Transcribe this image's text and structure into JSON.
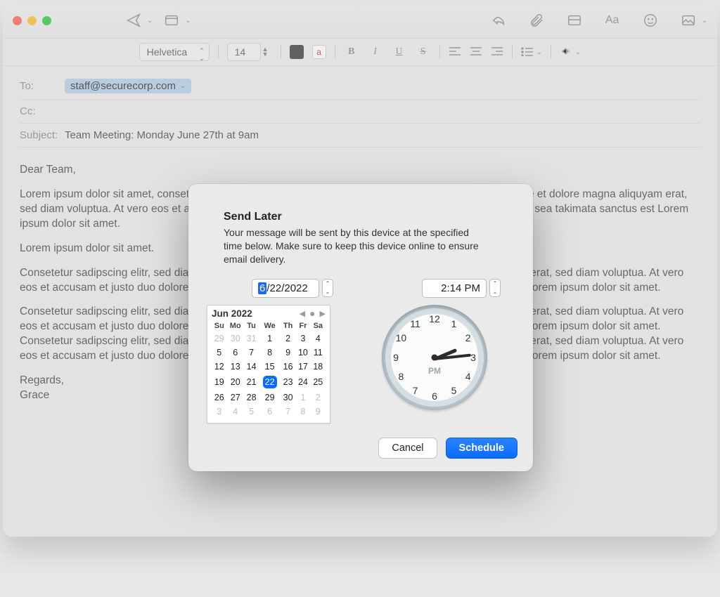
{
  "format": {
    "font": "Helvetica",
    "size": "14",
    "color_sample": "a"
  },
  "headers": {
    "to_label": "To:",
    "to_recipient": "staff@securecorp.com",
    "cc_label": "Cc:",
    "subject_label": "Subject:",
    "subject_value": "Team Meeting: Monday June 27th at 9am"
  },
  "body": {
    "p1": "Dear Team,",
    "p2": "Lorem ipsum dolor sit amet, consetetur sadipscing elitr, sed diam nonumy eirmod tempor invidunt ut labore et dolore magna aliquyam erat, sed diam voluptua. At vero eos et accusam et justo duo dolores et ea rebum. Stet clita kasd gubergren, no sea takimata sanctus est Lorem ipsum dolor sit amet.",
    "p3": "Lorem ipsum dolor sit amet.",
    "p4": "Consetetur sadipscing elitr, sed diam nonumy eirmod tempor invidunt ut labore et dolore magna aliquyam erat, sed diam voluptua. At vero eos et accusam et justo duo dolores et ea rebum. Stet clita kasd gubergren, no sea takimata sanctus est Lorem ipsum dolor sit amet.",
    "p5": "Consetetur sadipscing elitr, sed diam nonumy eirmod tempor invidunt ut labore et dolore magna aliquyam erat, sed diam voluptua. At vero eos et accusam et justo duo dolores et ea rebum. Stet clita kasd gubergren, no sea takimata sanctus est Lorem ipsum dolor sit amet. Consetetur sadipscing elitr, sed diam nonumy eirmod tempor invidunt ut labore et dolore magna aliquyam erat, sed diam voluptua. At vero eos et accusam et justo duo dolores et ea rebum. Stet clita kasd gubergren, no sea takimata sanctus est Lorem ipsum dolor sit amet.",
    "p6": "Regards,\nGrace"
  },
  "dialog": {
    "title": "Send Later",
    "desc": "Your message will be sent by this device at the specified time below. Make sure to keep this device online to ensure email delivery.",
    "date_prefix_sel": "6",
    "date_rest": "/22/2022",
    "time": "2:14 PM",
    "calendar": {
      "title": "Jun 2022",
      "dow": [
        "Su",
        "Mo",
        "Tu",
        "We",
        "Th",
        "Fr",
        "Sa"
      ],
      "weeks": [
        [
          {
            "d": "29",
            "o": true
          },
          {
            "d": "30",
            "o": true
          },
          {
            "d": "31",
            "o": true
          },
          {
            "d": "1"
          },
          {
            "d": "2"
          },
          {
            "d": "3"
          },
          {
            "d": "4"
          }
        ],
        [
          {
            "d": "5"
          },
          {
            "d": "6"
          },
          {
            "d": "7"
          },
          {
            "d": "8"
          },
          {
            "d": "9"
          },
          {
            "d": "10"
          },
          {
            "d": "11"
          }
        ],
        [
          {
            "d": "12"
          },
          {
            "d": "13"
          },
          {
            "d": "14"
          },
          {
            "d": "15"
          },
          {
            "d": "16"
          },
          {
            "d": "17"
          },
          {
            "d": "18"
          }
        ],
        [
          {
            "d": "19"
          },
          {
            "d": "20"
          },
          {
            "d": "21"
          },
          {
            "d": "22",
            "today": true
          },
          {
            "d": "23"
          },
          {
            "d": "24"
          },
          {
            "d": "25"
          }
        ],
        [
          {
            "d": "26"
          },
          {
            "d": "27"
          },
          {
            "d": "28"
          },
          {
            "d": "29"
          },
          {
            "d": "30"
          },
          {
            "d": "1",
            "o": true
          },
          {
            "d": "2",
            "o": true
          }
        ],
        [
          {
            "d": "3",
            "o": true
          },
          {
            "d": "4",
            "o": true
          },
          {
            "d": "5",
            "o": true
          },
          {
            "d": "6",
            "o": true
          },
          {
            "d": "7",
            "o": true
          },
          {
            "d": "8",
            "o": true
          },
          {
            "d": "9",
            "o": true
          }
        ]
      ]
    },
    "clock": {
      "ampm": "PM",
      "hour": 2,
      "minute": 14
    },
    "cancel": "Cancel",
    "schedule": "Schedule"
  }
}
